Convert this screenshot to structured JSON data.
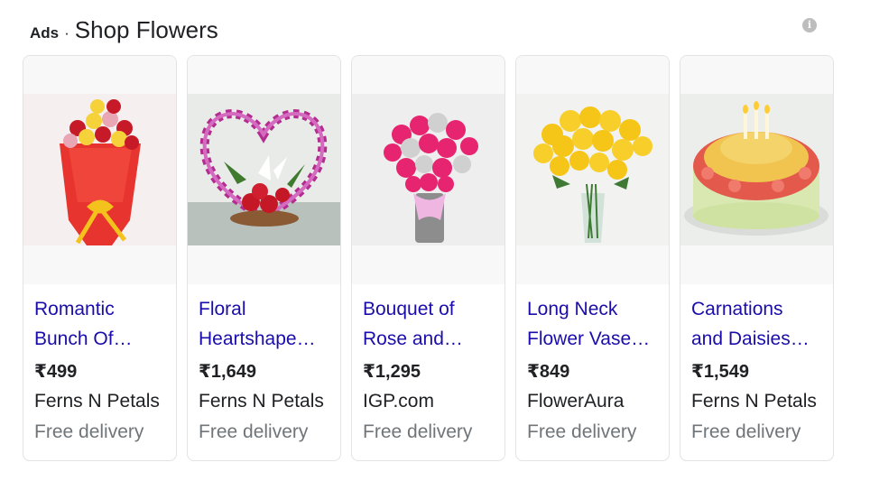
{
  "header": {
    "ads_label": "Ads",
    "separator": "·",
    "title": "Shop Flowers",
    "info_icon": "info-icon"
  },
  "products": [
    {
      "title": "Romantic\nBunch Of…",
      "price": "₹499",
      "seller": "Ferns N Petals",
      "delivery": "Free delivery",
      "image": "red-yellow-rose-bouquet"
    },
    {
      "title": "Floral\nHeartshape…",
      "price": "₹1,649",
      "seller": "Ferns N Petals",
      "delivery": "Free delivery",
      "image": "orchid-heart-basket"
    },
    {
      "title": "Bouquet of\nRose and…",
      "price": "₹1,295",
      "seller": "IGP.com",
      "delivery": "Free delivery",
      "image": "pink-white-rose-vase"
    },
    {
      "title": "Long Neck\nFlower Vase…",
      "price": "₹849",
      "seller": "FlowerAura",
      "delivery": "Free delivery",
      "image": "yellow-rose-vase"
    },
    {
      "title": "Carnations\nand Daisies…",
      "price": "₹1,549",
      "seller": "Ferns N Petals",
      "delivery": "Free delivery",
      "image": "carnation-cake"
    }
  ],
  "colors": {
    "link": "#1a0dab",
    "text": "#202124",
    "muted": "#70757a",
    "border": "#e3e3e3"
  }
}
